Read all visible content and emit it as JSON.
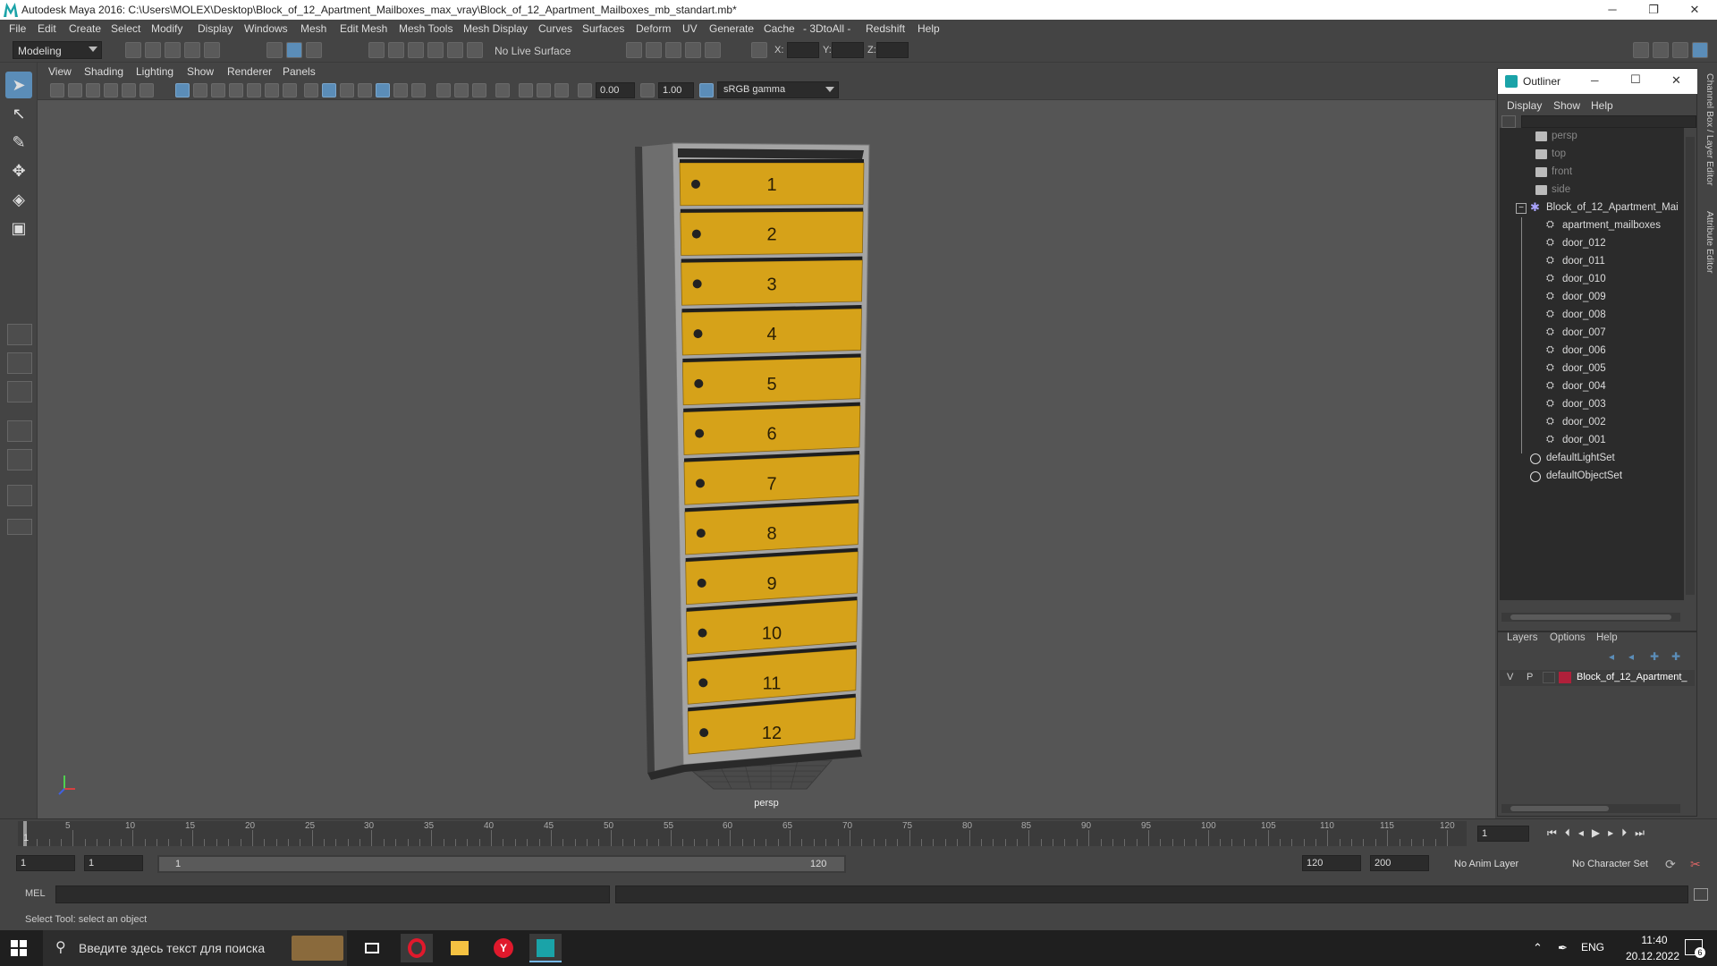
{
  "window": {
    "title": "Autodesk Maya 2016: C:\\Users\\MOLEX\\Desktop\\Block_of_12_Apartment_Mailboxes_max_vray\\Block_of_12_Apartment_Mailboxes_mb_standart.mb*",
    "minimize": "─",
    "maximize": "❐",
    "close": "✕"
  },
  "menubar": [
    "File",
    "Edit",
    "Create",
    "Select",
    "Modify",
    "Display",
    "Windows",
    "Mesh",
    "Edit Mesh",
    "Mesh Tools",
    "Mesh Display",
    "Curves",
    "Surfaces",
    "Deform",
    "UV",
    "Generate",
    "Cache",
    "- 3DtoAll -",
    "Redshift",
    "Help"
  ],
  "statusline": {
    "mode": "Modeling",
    "live_surface": "No Live Surface",
    "x_label": "X:",
    "y_label": "Y:",
    "z_label": "Z:"
  },
  "viewport": {
    "menu": [
      "View",
      "Shading",
      "Lighting",
      "Show",
      "Renderer",
      "Panels"
    ],
    "exposure": "0.00",
    "gamma": "1.00",
    "color_space": "sRGB gamma",
    "camera_label": "persp",
    "mailbox_numbers": [
      "1",
      "2",
      "3",
      "4",
      "5",
      "6",
      "7",
      "8",
      "9",
      "10",
      "11",
      "12"
    ]
  },
  "outliner": {
    "title": "Outliner",
    "menu": [
      "Display",
      "Show",
      "Help"
    ],
    "cameras": [
      "persp",
      "top",
      "front",
      "side"
    ],
    "group": "Block_of_12_Apartment_Mai",
    "children": [
      "apartment_mailboxes",
      "door_012",
      "door_011",
      "door_010",
      "door_009",
      "door_008",
      "door_007",
      "door_006",
      "door_005",
      "door_004",
      "door_003",
      "door_002",
      "door_001"
    ],
    "sets": [
      "defaultLightSet",
      "defaultObjectSet"
    ]
  },
  "layers": {
    "menu": [
      "Layers",
      "Options",
      "Help"
    ],
    "v": "V",
    "p": "P",
    "layer_name": "Block_of_12_Apartment_",
    "layer_color": "#b0203a"
  },
  "side_tabs": [
    "Channel Box / Layer Editor",
    "Attribute Editor"
  ],
  "timeline": {
    "ticks": [
      "5",
      "10",
      "15",
      "20",
      "25",
      "30",
      "35",
      "40",
      "45",
      "50",
      "55",
      "60",
      "65",
      "70",
      "75",
      "80",
      "85",
      "90",
      "95",
      "100",
      "105",
      "110",
      "115",
      "120"
    ],
    "first_frame_label": "1",
    "current_frame": "1"
  },
  "range": {
    "start": "1",
    "start2": "1",
    "slider_start": "1",
    "slider_end": "120",
    "end": "120",
    "end2": "200",
    "anim_layer": "No Anim Layer",
    "char_set": "No Character Set"
  },
  "cmdline": {
    "label": "MEL"
  },
  "helpline": {
    "text": "Select Tool: select an object"
  },
  "taskbar": {
    "search_placeholder": "Введите здесь текст для поиска",
    "lang": "ENG",
    "time": "11:40",
    "date": "20.12.2022",
    "notif_count": "6"
  },
  "colors": {
    "accent": "#5b8db8",
    "mailbox_door": "#d6a219",
    "frame": "#9a9a9a"
  }
}
